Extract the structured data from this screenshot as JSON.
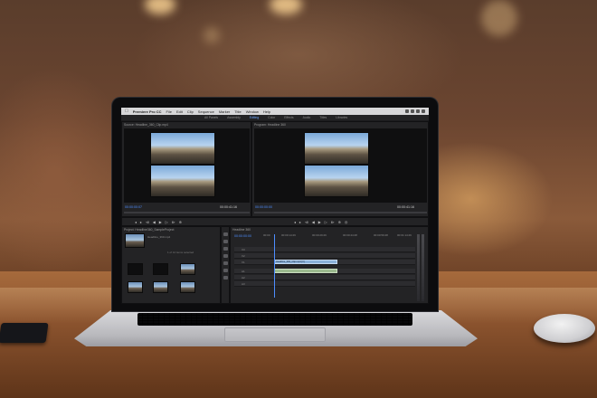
{
  "menubar": {
    "app_name": "Premiere Pro CC",
    "items": [
      "File",
      "Edit",
      "Clip",
      "Sequence",
      "Marker",
      "Title",
      "Window",
      "Help"
    ]
  },
  "workspace_tabs": [
    "All Panels",
    "Assembly",
    "Editing",
    "Color",
    "Effects",
    "Audio",
    "Titles",
    "Libraries"
  ],
  "source_panel": {
    "title": "Source: Headline_360_Clip.mp4",
    "timecode_in": "00:00:00:07",
    "timecode_out": "00:00:41:16"
  },
  "program_panel": {
    "title": "Program: Headline 360",
    "timecode_in": "00:00:00:00",
    "timecode_out": "00:00:41:16"
  },
  "project_panel": {
    "title": "Project: Headline360_SampleProject",
    "selected_item": "Headline_360.mp4",
    "item_count": "1 of 12 items selected"
  },
  "timeline_panel": {
    "title": "Headline 360",
    "timecode": "00:00:00:00",
    "ruler": [
      "00:00",
      "00:00:14:29",
      "00:00:29:29",
      "00:00:44:28",
      "00:00:59:28",
      "00:01:14:29"
    ],
    "tracks": [
      "V3",
      "V2",
      "V1",
      "A1",
      "A2",
      "A3"
    ],
    "clip_label": "Headline_360_Clip.mp4 [V]"
  },
  "colors": {
    "accent_blue": "#4d8dff",
    "panel_bg": "#232325",
    "video_clip": "#8ab0d8",
    "audio_clip": "#9bb98e"
  }
}
